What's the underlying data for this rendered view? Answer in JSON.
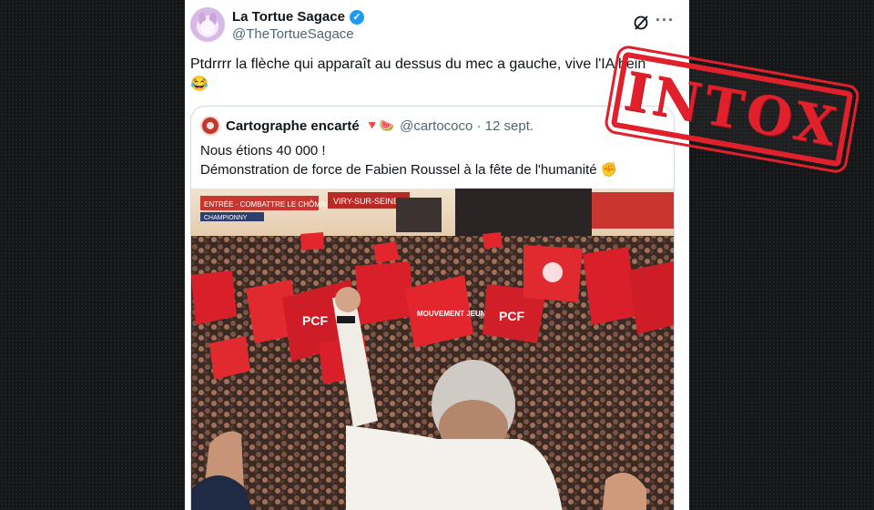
{
  "tweet": {
    "display_name": "La Tortue Sagace",
    "handle": "@TheTortueSagace",
    "text": "Ptdrrrr la flèche qui apparaît au dessus du mec a gauche, vive l'IA hein",
    "emoji": "😂",
    "more_label": "···"
  },
  "quote": {
    "display_name": "Cartographe encarté",
    "emojis": "🔻🍉",
    "handle_date": "@cartococo · 12 sept.",
    "line1": "Nous étions 40 000 !",
    "line2": "Démonstration de force de Fabien Roussel à la fête de l'humanité",
    "line2_emoji": "✊"
  },
  "photo": {
    "banner_left": "ENTRÉE · COMBATTRE LE CHÔMAGE",
    "banner_mid": "VIRY-SUR-SEINE",
    "flag_pcf": "PCF",
    "flag_mjcf": "MOUVEMENT JEUNES",
    "stage_sign": "CHAMPIONNY"
  },
  "stamp": {
    "label": "INTOX",
    "color": "#e0202a"
  },
  "colors": {
    "verified": "#1d9bf0",
    "flag_red": "#d81f2a",
    "background": "#141618"
  }
}
